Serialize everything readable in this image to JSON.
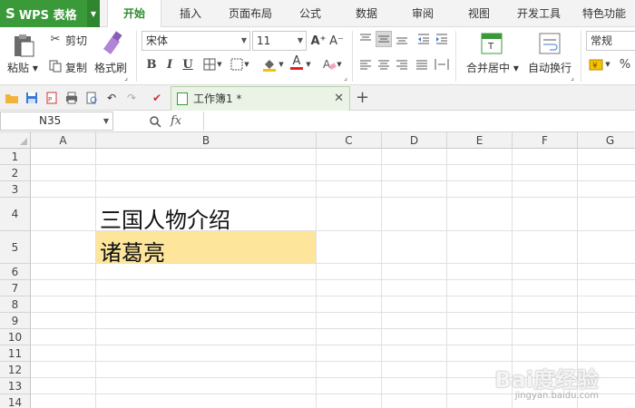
{
  "app": {
    "logo": "S",
    "name": "WPS 表格"
  },
  "menu_tabs": [
    "开始",
    "插入",
    "页面布局",
    "公式",
    "数据",
    "审阅",
    "视图",
    "开发工具",
    "特色功能"
  ],
  "ribbon": {
    "paste": "粘贴",
    "cut": "剪切",
    "copy": "复制",
    "format_painter": "格式刷",
    "font_name": "宋体",
    "font_size": "11",
    "bold": "B",
    "italic": "I",
    "underline": "U",
    "grow_font": "A⁺",
    "shrink_font": "A⁻",
    "merge_center": "合并居中",
    "wrap_text": "自动换行",
    "number_format": "常规",
    "percent": "%"
  },
  "document": {
    "tab_title": "工作簿1 *"
  },
  "formula_bar": {
    "cell_ref": "N35",
    "fx": "fx"
  },
  "sheet": {
    "columns": [
      "A",
      "B",
      "C",
      "D",
      "E",
      "F",
      "G"
    ],
    "rows": [
      "1",
      "2",
      "3",
      "4",
      "5",
      "6",
      "7",
      "8",
      "9",
      "10",
      "11",
      "12",
      "13",
      "14"
    ],
    "cells": {
      "B4": "三国人物介绍",
      "B5": "诸葛亮"
    },
    "highlight_color": "#fde59b"
  },
  "watermark": {
    "brand": "Bai度经验",
    "url": "jingyan.baidu.com"
  },
  "colors": {
    "brand_green": "#3a9a3a",
    "active_tab_text": "#2e8b2e"
  }
}
